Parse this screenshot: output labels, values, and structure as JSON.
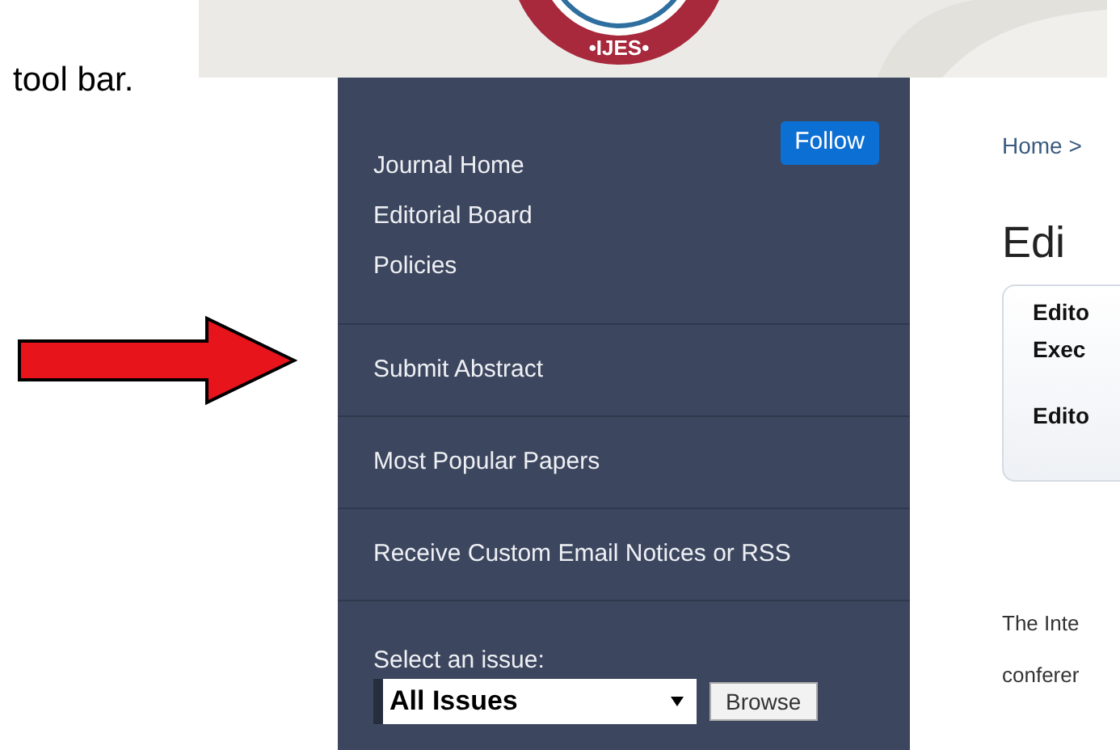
{
  "caption": "tool bar.",
  "banner": {
    "logo_text": "•IJES•"
  },
  "sidebar": {
    "follow_button": "Follow",
    "groups": [
      {
        "items": [
          "Journal Home",
          "Editorial Board",
          "Policies"
        ]
      },
      {
        "items": [
          "Submit Abstract"
        ]
      },
      {
        "items": [
          "Most Popular Papers"
        ]
      },
      {
        "items": [
          "Receive Custom Email Notices or RSS"
        ]
      }
    ],
    "issue_label": "Select an issue:",
    "issue_select": "All Issues",
    "browse_button": "Browse"
  },
  "content": {
    "breadcrumb": "Home >",
    "heading": "Edi",
    "box_lines": [
      "Edito",
      "Exec",
      "Edito"
    ],
    "paragraph_lines": [
      "The Inte",
      "conferer"
    ]
  }
}
